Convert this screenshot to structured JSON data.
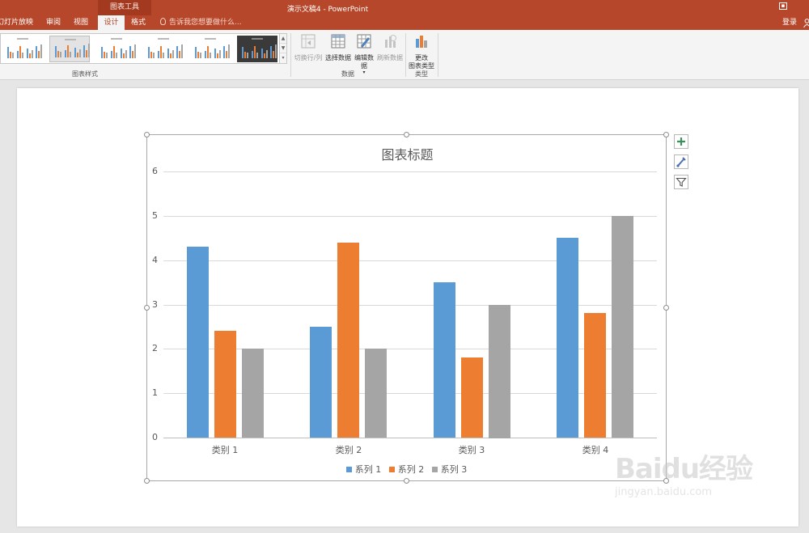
{
  "window": {
    "title": "演示文稿4 - PowerPoint",
    "context_tab": "图表工具",
    "login": "登录"
  },
  "tabs": [
    {
      "label": "幻灯片放映"
    },
    {
      "label": "审阅"
    },
    {
      "label": "视图"
    },
    {
      "label": "设计",
      "active": true
    },
    {
      "label": "格式"
    }
  ],
  "tell_me": "告诉我您想要做什么...",
  "ribbon": {
    "groups": {
      "chart_styles": "图表样式",
      "data": "数据",
      "type": "类型"
    },
    "buttons": {
      "switch_row_col": "切换行/列",
      "select_data": "选择数据",
      "edit_data": "编辑数据",
      "refresh_data": "刷新数据",
      "change_chart_type_1": "更改",
      "change_chart_type_2": "图表类型"
    },
    "icons": {
      "switch_row_col": "switch-row-column-icon",
      "select_data": "select-data-icon",
      "edit_data": "edit-data-icon",
      "refresh_data": "refresh-data-icon",
      "change_type": "change-chart-type-icon"
    }
  },
  "side_buttons": {
    "add": "chart-elements-icon",
    "style": "chart-styles-icon",
    "filter": "chart-filters-icon"
  },
  "colors": {
    "accent": "#b7472a",
    "series1": "#5b9bd5",
    "series2": "#ed7d31",
    "series3": "#a5a5a5"
  },
  "watermark": {
    "brand": "Baidu经验",
    "url": "jingyan.baidu.com"
  },
  "chart_data": {
    "type": "bar",
    "title": "图表标题",
    "categories": [
      "类别 1",
      "类别 2",
      "类别 3",
      "类别 4"
    ],
    "series": [
      {
        "name": "系列 1",
        "values": [
          4.3,
          2.5,
          3.5,
          4.5
        ]
      },
      {
        "name": "系列 2",
        "values": [
          2.4,
          4.4,
          1.8,
          2.8
        ]
      },
      {
        "name": "系列 3",
        "values": [
          2,
          2,
          3,
          5
        ]
      }
    ],
    "ylim": [
      0,
      6
    ],
    "yticks": [
      0,
      1,
      2,
      3,
      4,
      5,
      6
    ],
    "grid": true,
    "legend": "bottom"
  }
}
